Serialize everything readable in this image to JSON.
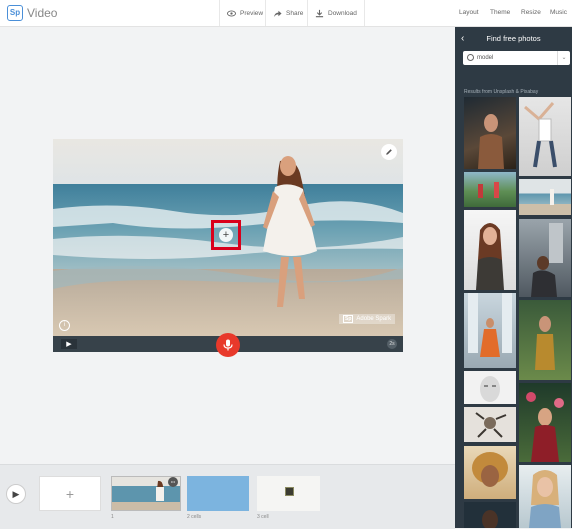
{
  "app": {
    "logo_text": "Sp",
    "name": "Video"
  },
  "toolbar": {
    "preview": "Preview",
    "share": "Share",
    "download": "Download"
  },
  "menu": [
    "Layout",
    "Theme",
    "Resize",
    "Music"
  ],
  "slide": {
    "watermark_badge": "Sp",
    "watermark": "Adobe Spark",
    "duration": "2s",
    "info": "i",
    "add": "+"
  },
  "sidebar": {
    "back": "‹",
    "title": "Find free photos",
    "search_value": "model",
    "caption": "Results from Unsplash & Pixabay"
  },
  "timeline": {
    "add": "+",
    "slides": [
      "1",
      "2 cells",
      "3 cell"
    ],
    "menu": "•••"
  },
  "colors": {
    "accent": "#4a8fd8",
    "mic": "#e8392b",
    "highlight": "#d9001b",
    "sidebar": "#2e3a44"
  }
}
